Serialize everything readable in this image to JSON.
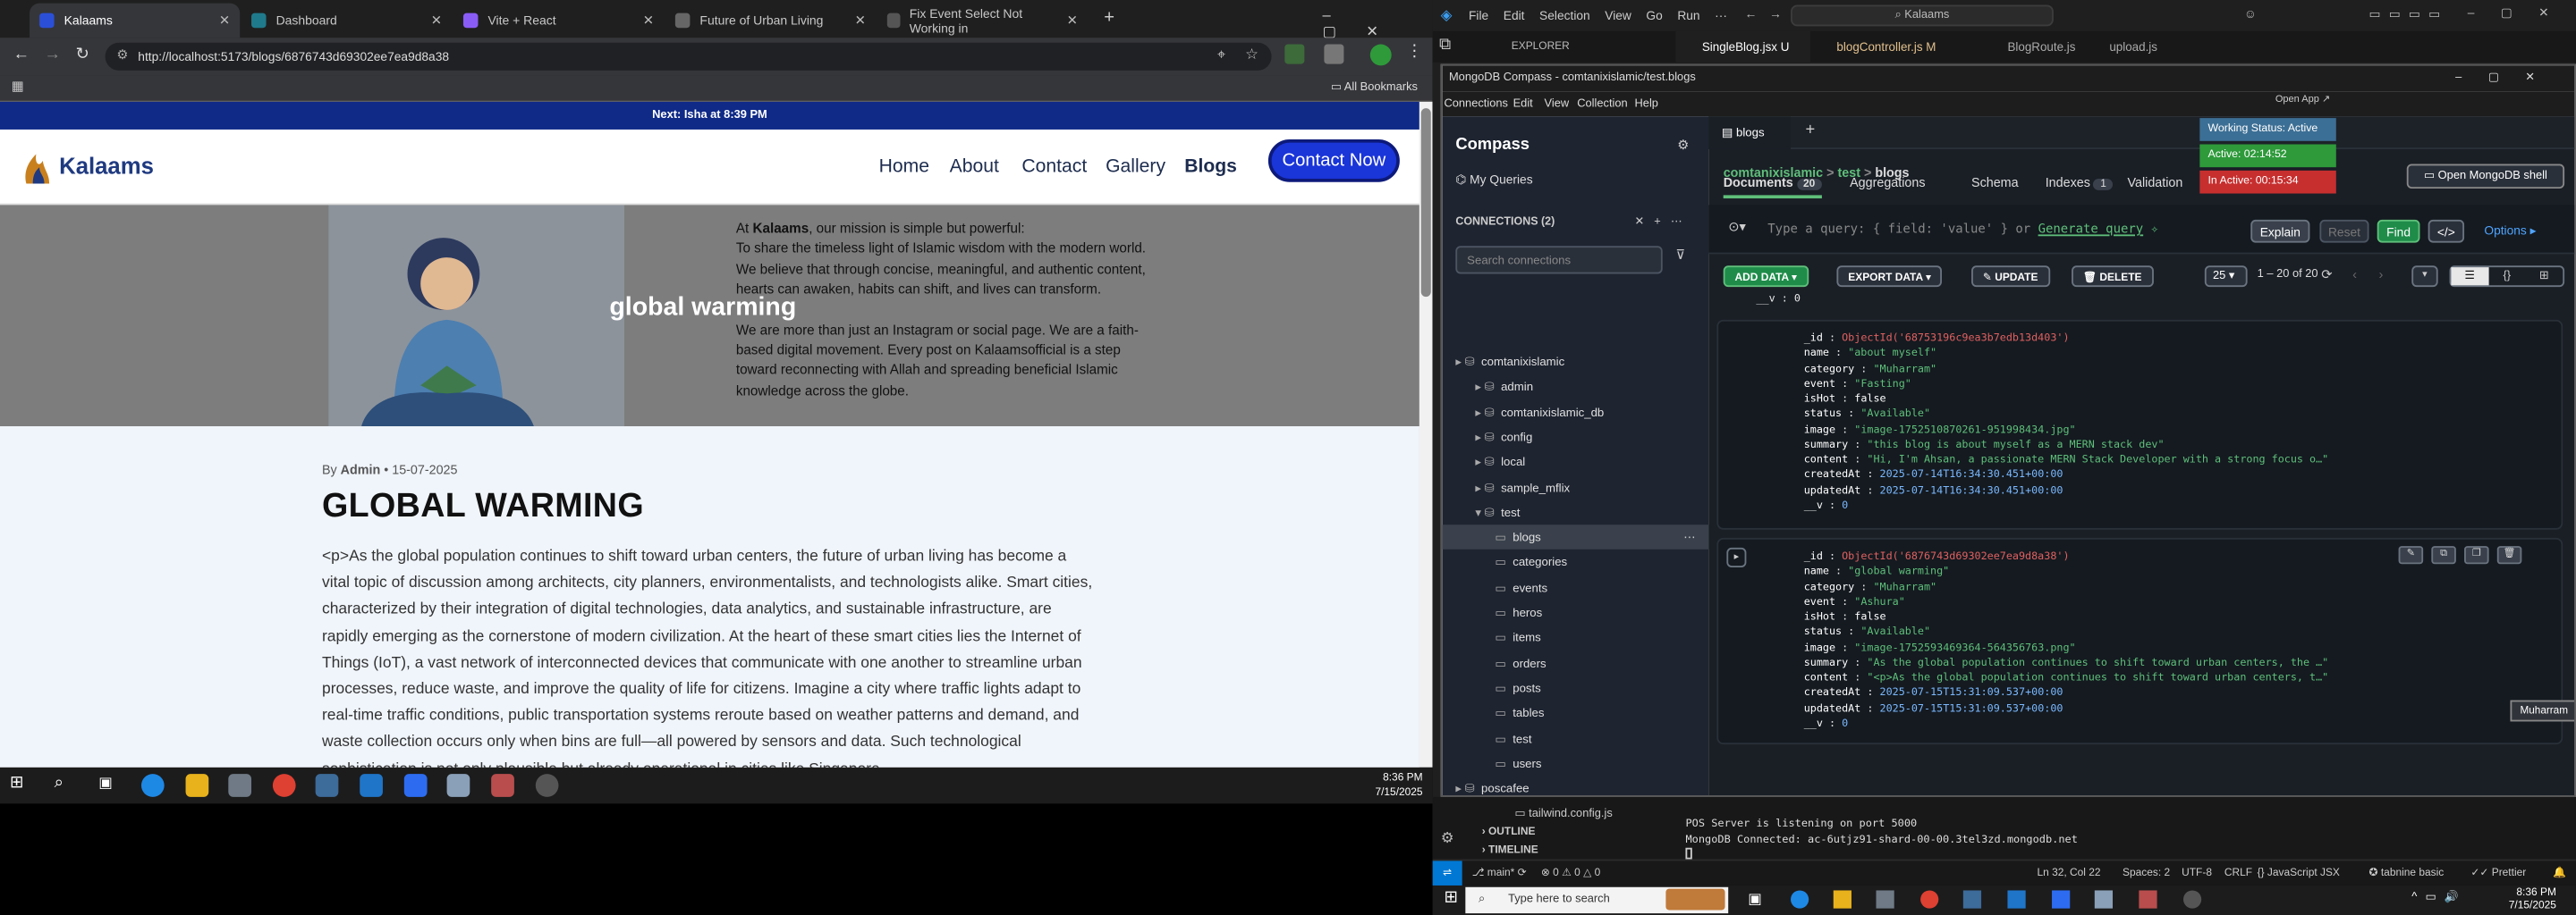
{
  "chrome": {
    "tabs": [
      {
        "title": "Kalaams",
        "color": "#2b4fd6"
      },
      {
        "title": "Dashboard",
        "color": "#1f7a8c"
      },
      {
        "title": "Vite + React",
        "color": "#8a5cf6"
      },
      {
        "title": "Future of Urban Living",
        "color": "#666"
      },
      {
        "title": "Fix Event Select Not Working in",
        "color": "#555"
      }
    ],
    "new_tab": "+",
    "url": "http://localhost:5173/blogs/6876743d69302ee7ea9d8a38",
    "all_bookmarks": "All Bookmarks"
  },
  "site": {
    "top_banner": "Next: Isha at 8:39 PM",
    "logo": "Kalaams",
    "nav": [
      "Home",
      "About",
      "Contact",
      "Gallery",
      "Blogs"
    ],
    "contact_btn": "Contact Now",
    "hero_title": "global warming",
    "hero_p1_pre": "At ",
    "hero_p1_bold": "Kalaams",
    "hero_p1_post": ", our mission is simple but powerful:",
    "hero_p2": "To share the timeless light of Islamic wisdom with the modern world. We believe that through concise, meaningful, and authentic content, hearts can awaken, habits can shift, and lives can transform.",
    "hero_p3": "We are more than just an Instagram or social page. We are a faith-based digital movement. Every post on Kalaamsofficial is a step toward reconnecting with Allah and spreading beneficial Islamic knowledge across the globe.",
    "byline_pre": "By ",
    "author": "Admin",
    "date": "• 15-07-2025",
    "article_title": "GLOBAL WARMING",
    "article_body": "<p>As the global population continues to shift toward urban centers, the future of urban living has become a vital topic of discussion among architects, city planners, environmentalists, and technologists alike. Smart cities, characterized by their integration of digital technologies, data analytics, and sustainable infrastructure, are rapidly emerging as the cornerstone of modern civilization. At the heart of these smart cities lies the Internet of Things (IoT), a vast network of interconnected devices that communicate with one another to streamline urban processes, reduce waste, and improve the quality of life for citizens. Imagine a city where traffic lights adapt to real-time traffic conditions, public transportation systems reroute based on weather patterns and demand, and waste collection occurs only when bins are full—all powered by sensors and data. Such technological sophistication is not only plausible but already operational in cities like Singapore,"
  },
  "taskbar_left": {
    "time": "8:36 PM",
    "date": "7/15/2025"
  },
  "vscode": {
    "menu": [
      "File",
      "Edit",
      "Selection",
      "View",
      "Go",
      "Run",
      "···"
    ],
    "command": "Kalaams",
    "explorer": "EXPLORER",
    "tabs": [
      "SingleBlog.jsx U",
      "blogController.js M",
      "BlogRoute.js",
      "upload.js"
    ],
    "outline": "OUTLINE",
    "timeline": "TIMELINE",
    "file_item": "tailwind.config.js",
    "terminal": [
      "POS Server is listening on port 5000",
      "MongoDB Connected: ac-6utjz91-shard-00-00.3tel3zd.mongodb.net"
    ],
    "status_left": [
      "main*",
      "⊗ 0 ⚠ 0 △ 0"
    ],
    "status_right": [
      "Ln 32, Col 22",
      "Spaces: 2",
      "UTF-8",
      "CRLF",
      "{} JavaScript JSX",
      "tabnine basic",
      "Prettier"
    ]
  },
  "compass": {
    "title": "MongoDB Compass - comtanixislamic/test.blogs",
    "menu": [
      "Connections",
      "Edit",
      "View",
      "Collection",
      "Help"
    ],
    "open_app": "Open App ↗",
    "brand": "Compass",
    "my_queries": "My Queries",
    "connections_label": "CONNECTIONS (2)",
    "search_placeholder": "Search connections",
    "tree": [
      {
        "label": "comtanixislamic",
        "level": 0,
        "kind": "conn"
      },
      {
        "label": "admin",
        "level": 1,
        "kind": "db"
      },
      {
        "label": "comtanixislamic_db",
        "level": 1,
        "kind": "db"
      },
      {
        "label": "config",
        "level": 1,
        "kind": "db"
      },
      {
        "label": "local",
        "level": 1,
        "kind": "db"
      },
      {
        "label": "sample_mflix",
        "level": 1,
        "kind": "db"
      },
      {
        "label": "test",
        "level": 1,
        "kind": "db-open"
      },
      {
        "label": "blogs",
        "level": 2,
        "kind": "coll-sel"
      },
      {
        "label": "categories",
        "level": 2,
        "kind": "coll"
      },
      {
        "label": "events",
        "level": 2,
        "kind": "coll"
      },
      {
        "label": "heros",
        "level": 2,
        "kind": "coll"
      },
      {
        "label": "items",
        "level": 2,
        "kind": "coll"
      },
      {
        "label": "orders",
        "level": 2,
        "kind": "coll"
      },
      {
        "label": "posts",
        "level": 2,
        "kind": "coll"
      },
      {
        "label": "tables",
        "level": 2,
        "kind": "coll"
      },
      {
        "label": "test",
        "level": 2,
        "kind": "coll"
      },
      {
        "label": "users",
        "level": 2,
        "kind": "coll"
      },
      {
        "label": "poscafee",
        "level": 0,
        "kind": "conn"
      }
    ],
    "tab_label": "blogs",
    "breadcrumb": [
      "comtanixislamic",
      ">",
      "test",
      ">",
      "blogs"
    ],
    "status": [
      {
        "text": "Working Status: Active",
        "color": "#3c6f95"
      },
      {
        "text": "Active: 02:14:52",
        "color": "#2e9a3a"
      },
      {
        "text": "In Active: 00:15:34",
        "color": "#c72f2f"
      }
    ],
    "open_shell": "Open MongoDB shell",
    "tabs": [
      {
        "label": "Documents",
        "badge": "20"
      },
      {
        "label": "Aggregations",
        "badge": ""
      },
      {
        "label": "Schema",
        "badge": ""
      },
      {
        "label": "Indexes",
        "badge": "1"
      },
      {
        "label": "Validation",
        "badge": ""
      }
    ],
    "query_placeholder": "Type a query: { field: 'value' } or",
    "generate_query": "Generate query",
    "explain": "Explain",
    "reset": "Reset",
    "find": "Find",
    "options": "Options ▸",
    "actions": [
      "ADD DATA ▾",
      "EXPORT DATA ▾",
      "✎ UPDATE",
      "🗑 DELETE"
    ],
    "page_size": "25",
    "range": "1 – 20 of 20",
    "tooltip": "Muharram",
    "prev_doc_tail": "__v : 0",
    "docs": [
      {
        "lines": [
          [
            "_id",
            "ObjectId('68753196c9ea3b7edb13d403')",
            "o"
          ],
          [
            "name",
            "\"about myself\"",
            "s"
          ],
          [
            "category",
            "\"Muharram\"",
            "s"
          ],
          [
            "event",
            "\"Fasting\"",
            "s"
          ],
          [
            "isHot",
            "false",
            "k"
          ],
          [
            "status",
            "\"Available\"",
            "s"
          ],
          [
            "image",
            "\"image-1752510870261-951998434.jpg\"",
            "s"
          ],
          [
            "summary",
            "\"this blog is about myself as a MERN stack dev\"",
            "s"
          ],
          [
            "content",
            "\"Hi, I'm Ahsan, a passionate MERN Stack Developer with a strong focus o…\"",
            "s"
          ],
          [
            "createdAt",
            "2025-07-14T16:34:30.451+00:00",
            "n"
          ],
          [
            "updatedAt",
            "2025-07-14T16:34:30.451+00:00",
            "n"
          ],
          [
            "__v",
            "0",
            "n"
          ]
        ]
      },
      {
        "lines": [
          [
            "_id",
            "ObjectId('6876743d69302ee7ea9d8a38')",
            "o"
          ],
          [
            "name",
            "\"global warming\"",
            "s"
          ],
          [
            "category",
            "\"Muharram\"",
            "s"
          ],
          [
            "event",
            "\"Ashura\"",
            "s"
          ],
          [
            "isHot",
            "false",
            "k"
          ],
          [
            "status",
            "\"Available\"",
            "s"
          ],
          [
            "image",
            "\"image-1752593469364-564356763.png\"",
            "s"
          ],
          [
            "summary",
            "\"As the global population continues to shift toward urban centers, the …\"",
            "s"
          ],
          [
            "content",
            "\"<p>As the global population continues to shift toward urban centers, t…\"",
            "s"
          ],
          [
            "createdAt",
            "2025-07-15T15:31:09.537+00:00",
            "n"
          ],
          [
            "updatedAt",
            "2025-07-15T15:31:09.537+00:00",
            "n"
          ],
          [
            "__v",
            "0",
            "n"
          ]
        ]
      }
    ]
  },
  "taskbar_right": {
    "search": "Type here to search",
    "time": "8:36 PM",
    "date": "7/15/2025"
  }
}
